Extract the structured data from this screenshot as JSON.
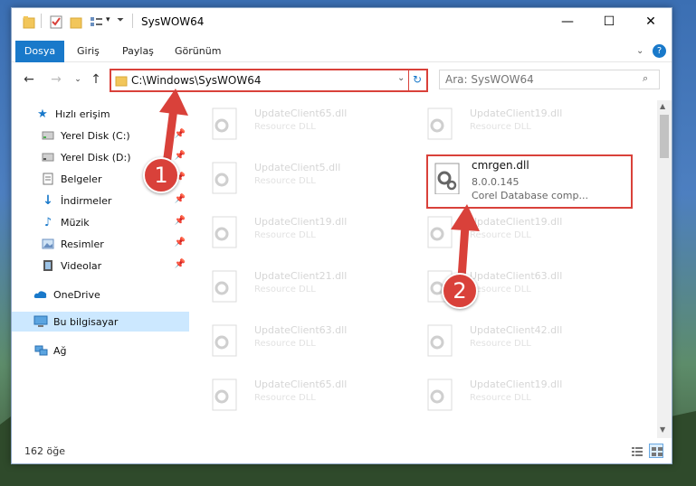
{
  "window": {
    "title": "SysWOW64",
    "minimize": "—",
    "maximize": "☐",
    "close": "✕"
  },
  "ribbon": {
    "tabs": [
      "Dosya",
      "Giriş",
      "Paylaş",
      "Görünüm"
    ]
  },
  "address": {
    "path": "C:\\Windows\\SysWOW64",
    "search_placeholder": "Ara: SysWOW64"
  },
  "sidebar": {
    "items": [
      {
        "label": "Hızlı erişim",
        "icon": "star-icon"
      },
      {
        "label": "Yerel Disk (C:)",
        "icon": "drive-icon"
      },
      {
        "label": "Yerel Disk (D:)",
        "icon": "drive-icon"
      },
      {
        "label": "Belgeler",
        "icon": "documents-icon"
      },
      {
        "label": "İndirmeler",
        "icon": "download-icon"
      },
      {
        "label": "Müzik",
        "icon": "music-icon"
      },
      {
        "label": "Resimler",
        "icon": "pictures-icon"
      },
      {
        "label": "Videolar",
        "icon": "video-icon"
      },
      {
        "label": "OneDrive",
        "icon": "cloud-icon"
      },
      {
        "label": "Bu bilgisayar",
        "icon": "computer-icon"
      },
      {
        "label": "Ağ",
        "icon": "network-icon"
      }
    ]
  },
  "files": {
    "left": [
      {
        "name": "UpdateClient65.dll",
        "desc": "Resource DLL"
      },
      {
        "name": "UpdateClient5.dll",
        "desc": "Resource DLL"
      },
      {
        "name": "UpdateClient19.dll",
        "desc": "Resource DLL"
      },
      {
        "name": "UpdateClient21.dll",
        "desc": "Resource DLL"
      },
      {
        "name": "UpdateClient63.dll",
        "desc": "Resource DLL"
      },
      {
        "name": "UpdateClient65.dll",
        "desc": "Resource DLL"
      }
    ],
    "right": [
      {
        "name": "UpdateClient19.dll",
        "desc": "Resource DLL"
      },
      {
        "name": "UpdateClient19.dll",
        "desc": "Resource DLL"
      },
      {
        "name": "UpdateClient63.dll",
        "desc": "Resource DLL"
      },
      {
        "name": "UpdateClient42.dll",
        "desc": "Resource DLL"
      },
      {
        "name": "UpdateClient19.dll",
        "desc": "Resource DLL"
      }
    ],
    "highlight": {
      "name": "cmrgen.dll",
      "version": "8.0.0.145",
      "desc": "Corel Database comp..."
    }
  },
  "status": {
    "count": "162 öğe"
  },
  "annotations": {
    "step1": "1",
    "step2": "2",
    "color": "#d9413a"
  }
}
